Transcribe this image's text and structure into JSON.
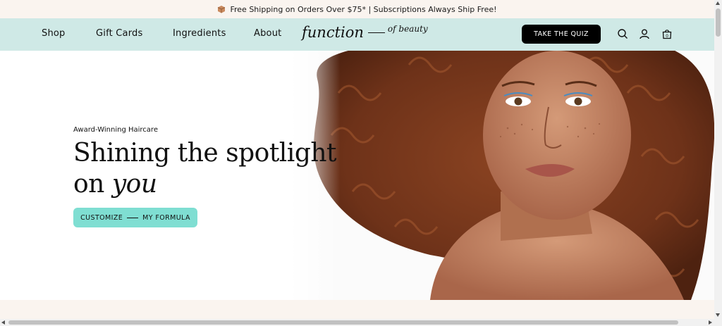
{
  "announcement": {
    "icon": "package-icon",
    "text": "Free Shipping on Orders Over $75* | Subscriptions Always Ship Free!"
  },
  "nav": {
    "links": [
      "Shop",
      "Gift Cards",
      "Ingredients",
      "About"
    ],
    "logo_main": "function",
    "logo_sub": "of beauty",
    "quiz_label": "TAKE THE QUIZ",
    "icons": [
      "search-icon",
      "account-icon",
      "cart-icon"
    ],
    "cart_count": "0"
  },
  "hero": {
    "eyebrow": "Award-Winning Haircare",
    "headline_line1": "Shining the spotlight",
    "headline_line2_plain": "on ",
    "headline_line2_em": "you",
    "cta_left": "CUSTOMIZE",
    "cta_right": "MY FORMULA",
    "image": "woman-curly-hair-portrait"
  },
  "colors": {
    "announcement_bg": "#faf4ef",
    "nav_bg": "#cfe9e6",
    "cta_bg": "#7fded2",
    "quiz_bg": "#000000",
    "hair": "#7a3a1c",
    "skin": "#b9785a"
  }
}
